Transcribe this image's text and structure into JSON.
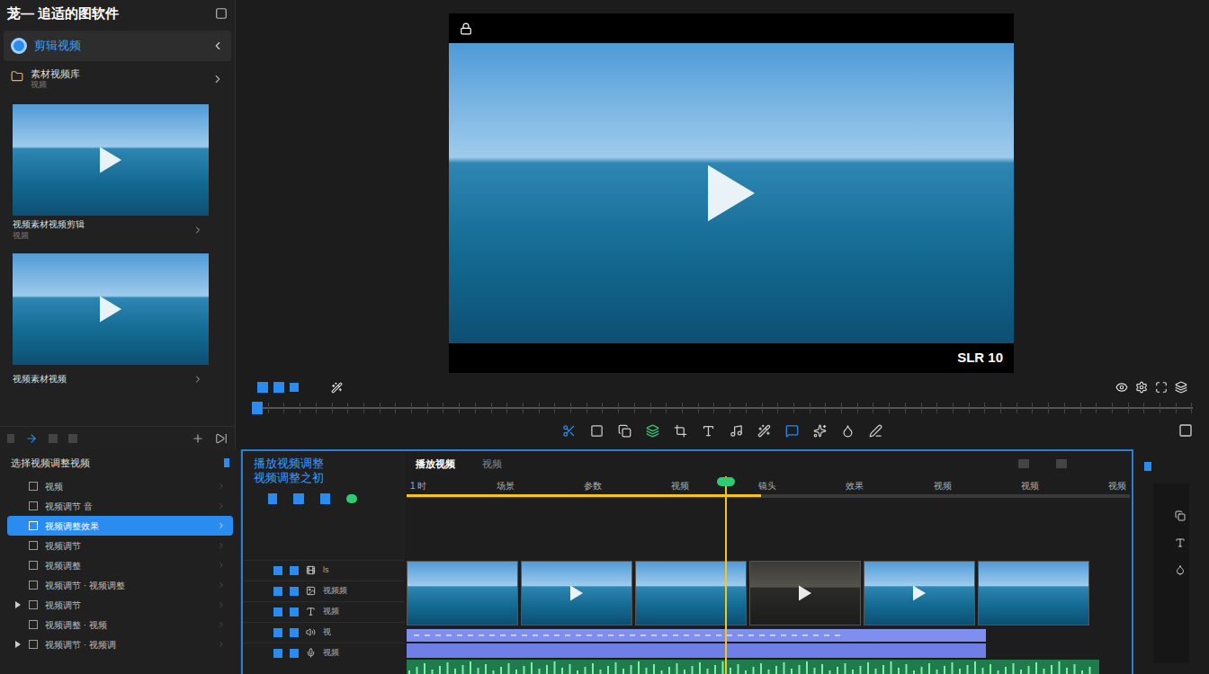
{
  "window": {
    "title": "茏— 追适的图软件"
  },
  "sidebar": {
    "active_item": {
      "label": "剪辑视频",
      "selected": true
    },
    "library": {
      "label": "素材视频库",
      "sub": "视频"
    },
    "media": [
      {
        "caption": "视频素材视频剪辑",
        "sub": "视频"
      },
      {
        "caption": "视频素材视频",
        "sub": ""
      }
    ]
  },
  "preview": {
    "label": "SLR 10",
    "scrub_level": 0
  },
  "tree": {
    "title": "选择视频调整视频",
    "items": [
      {
        "label": "视频",
        "selected": false,
        "has_children": false
      },
      {
        "label": "视频调节 音",
        "selected": false,
        "has_children": false
      },
      {
        "label": "视频调整效果",
        "selected": true,
        "has_children": false
      },
      {
        "label": "视频调节",
        "selected": false,
        "has_children": false
      },
      {
        "label": "视频调整",
        "selected": false,
        "has_children": false
      },
      {
        "label": "视频调节 · 视频调整",
        "selected": false,
        "has_children": false
      },
      {
        "label": "视频调节",
        "selected": false,
        "has_children": true
      },
      {
        "label": "视频调整 · 视频",
        "selected": false,
        "has_children": false
      },
      {
        "label": "视频调节 · 视频调",
        "selected": false,
        "has_children": true
      }
    ]
  },
  "tracks": {
    "title": "播放视频调整",
    "subtitle": "视频调整之初",
    "rows": [
      {
        "label": "ls"
      },
      {
        "label": "视频频"
      },
      {
        "label": "视频"
      },
      {
        "label": "视"
      },
      {
        "label": "视频"
      }
    ]
  },
  "timeline": {
    "tabs": [
      {
        "label": "播放视频",
        "selected": true
      },
      {
        "label": "视频",
        "selected": false
      }
    ],
    "ruler": [
      "1 时",
      "场景",
      "参数",
      "视频",
      "镜头",
      "效果",
      "视频",
      "视频",
      "视频"
    ],
    "playhead_level": 0.44,
    "progress_level": 0.49,
    "clips": [
      {
        "kind": "light",
        "play": false
      },
      {
        "kind": "light",
        "play": true
      },
      {
        "kind": "light",
        "play": false
      },
      {
        "kind": "dark",
        "play": true
      },
      {
        "kind": "light",
        "play": true
      },
      {
        "kind": "light",
        "play": false
      }
    ]
  }
}
